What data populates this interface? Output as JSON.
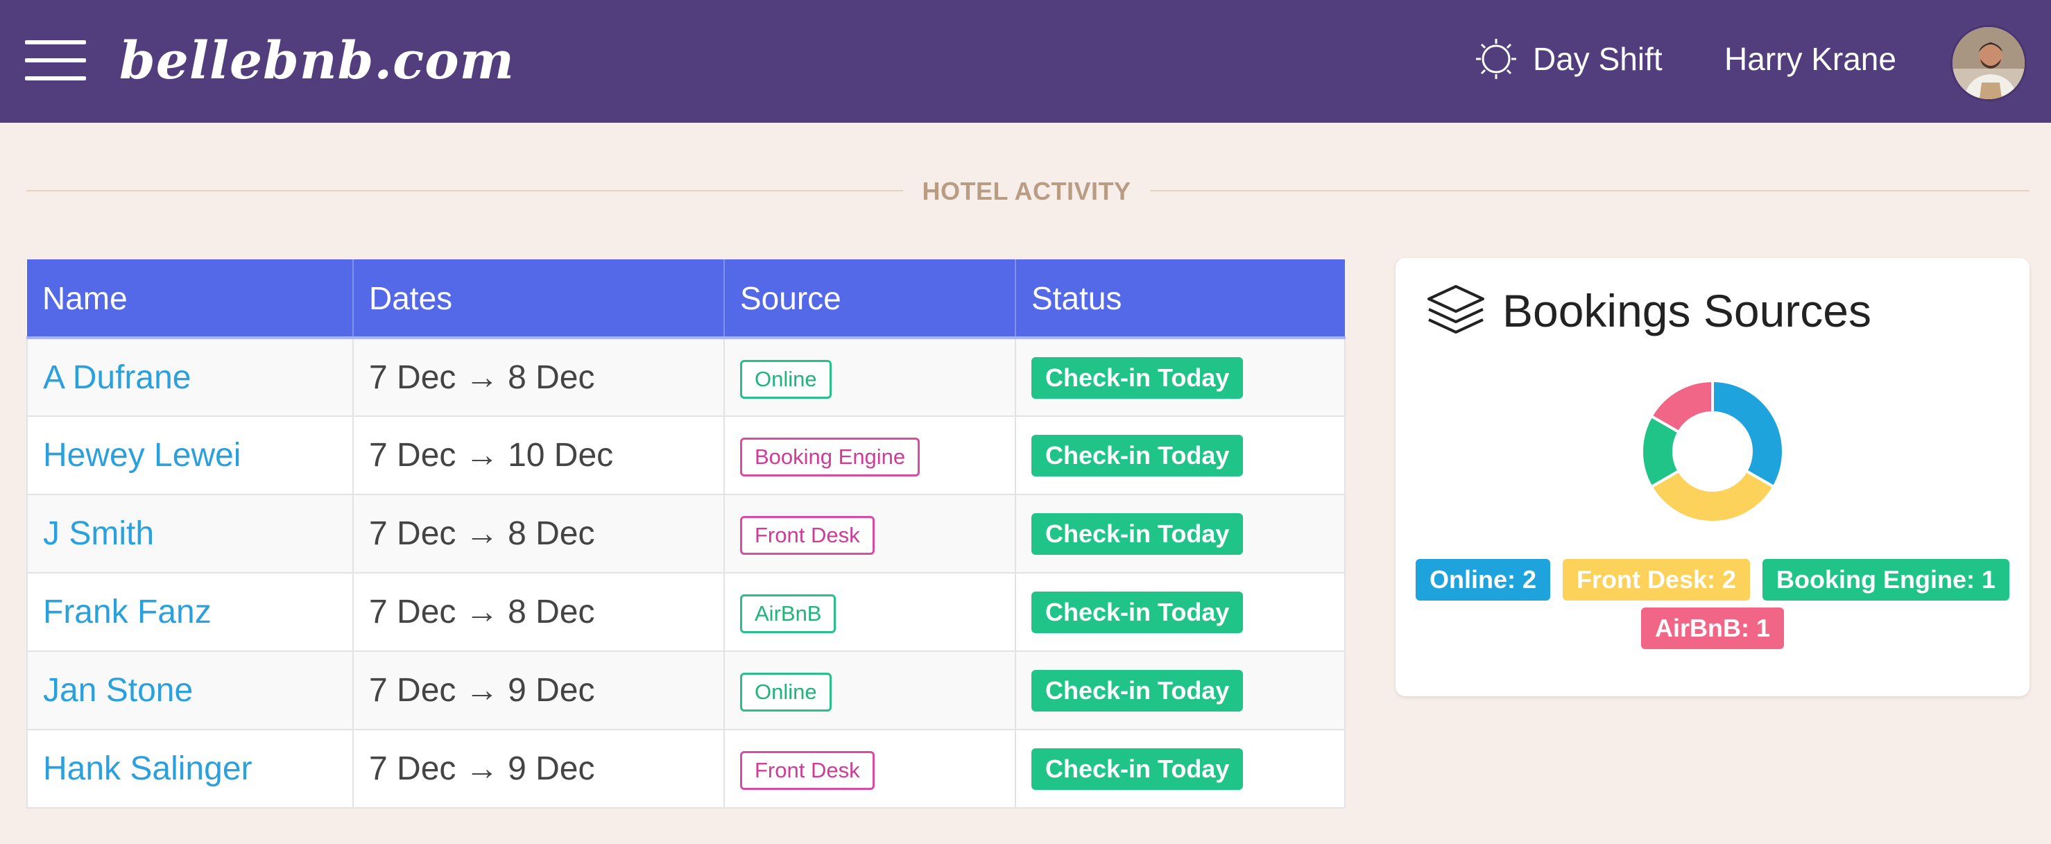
{
  "header": {
    "brand": "bellebnb.com",
    "shift_label": "Day Shift",
    "user_name": "Harry Krane"
  },
  "section": {
    "title": "HOTEL ACTIVITY"
  },
  "table": {
    "columns": [
      "Name",
      "Dates",
      "Source",
      "Status"
    ],
    "rows": [
      {
        "name": "A Dufrane",
        "dates": "7 Dec → 8 Dec",
        "source": "Online",
        "status": "Check-in Today"
      },
      {
        "name": "Hewey Lewei",
        "dates": "7 Dec → 10 Dec",
        "source": "Booking Engine",
        "status": "Check-in Today"
      },
      {
        "name": "J Smith",
        "dates": "7 Dec → 8 Dec",
        "source": "Front Desk",
        "status": "Check-in Today"
      },
      {
        "name": "Frank Fanz",
        "dates": "7 Dec → 8 Dec",
        "source": "AirBnB",
        "status": "Check-in Today"
      },
      {
        "name": "Jan Stone",
        "dates": "7 Dec → 9 Dec",
        "source": "Online",
        "status": "Check-in Today"
      },
      {
        "name": "Hank Salinger",
        "dates": "7 Dec → 9 Dec",
        "source": "Front Desk",
        "status": "Check-in Today"
      }
    ]
  },
  "bookings_card": {
    "title": "Bookings Sources",
    "legend": [
      {
        "label": "Online: 2",
        "color": "#1ea3dd"
      },
      {
        "label": "Front Desk: 2",
        "color": "#fdd25b"
      },
      {
        "label": "Booking Engine: 1",
        "color": "#20c489"
      },
      {
        "label": "AirBnB: 1",
        "color": "#f16687"
      }
    ]
  },
  "chart_data": {
    "type": "pie",
    "categories": [
      "Online",
      "Front Desk",
      "Booking Engine",
      "AirBnB"
    ],
    "values": [
      2,
      2,
      1,
      1
    ],
    "colors": [
      "#1ea3dd",
      "#fdd25b",
      "#20c489",
      "#f16687"
    ],
    "title": "",
    "xlabel": "",
    "ylabel": "",
    "legend": "bottom"
  },
  "colors": {
    "header_bg": "#533e7d",
    "page_bg": "#f7eee9",
    "table_header_bg": "#5469e7",
    "link": "#2aa0dd",
    "status_green": "#20c489",
    "source_green": "#20b37a",
    "source_pink": "#d03b96"
  },
  "icons": {
    "menu": "hamburger-icon",
    "shift": "sun-icon",
    "card": "layers-icon"
  }
}
